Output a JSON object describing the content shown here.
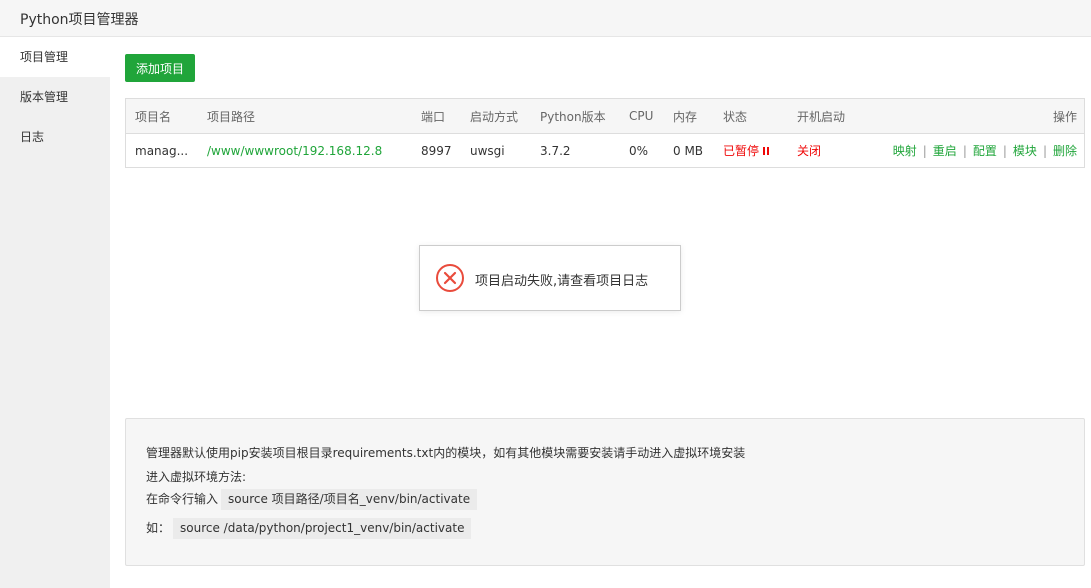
{
  "window": {
    "title": "Python项目管理器"
  },
  "sidebar": {
    "items": [
      {
        "label": "项目管理",
        "active": true
      },
      {
        "label": "版本管理",
        "active": false
      },
      {
        "label": "日志",
        "active": false
      }
    ]
  },
  "toolbar": {
    "add_label": "添加项目"
  },
  "table": {
    "headers": {
      "name": "项目名",
      "path": "项目路径",
      "port": "端口",
      "startup": "启动方式",
      "python": "Python版本",
      "cpu": "CPU",
      "mem": "内存",
      "status": "状态",
      "boot": "开机启动",
      "ops": "操作"
    },
    "rows": [
      {
        "name": "manag...",
        "path": "/www/wwwroot/192.168.12.8",
        "port": "8997",
        "startup": "uwsgi",
        "python": "3.7.2",
        "cpu": "0%",
        "mem": "0 MB",
        "status": "已暂停",
        "boot": "关闭",
        "ops": [
          "映射",
          "重启",
          "配置",
          "模块",
          "删除"
        ]
      }
    ]
  },
  "toast": {
    "message": "项目启动失败,请查看项目日志",
    "icon": "error-circle-icon"
  },
  "tips": {
    "line1": "管理器默认使用pip安装项目根目录requirements.txt内的模块，如有其他模块需要安装请手动进入虚拟环境安装",
    "line2": "进入虚拟环境方法:",
    "line3_label": "在命令行输入",
    "line3_code": "source 项目路径/项目名_venv/bin/activate",
    "line4_label": "如：",
    "line4_code": "source /data/python/project1_venv/bin/activate"
  },
  "colors": {
    "accent": "#20a53a",
    "danger": "#ef0808",
    "error_icon": "#e94b3c"
  }
}
